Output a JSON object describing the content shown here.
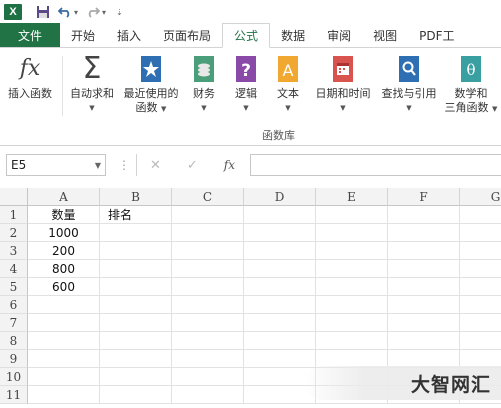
{
  "qat": {
    "app_icon": "X",
    "caret": "▾",
    "customize": "⇣"
  },
  "tabs": [
    "文件",
    "开始",
    "插入",
    "页面布局",
    "公式",
    "数据",
    "审阅",
    "视图",
    "PDF工"
  ],
  "active_tab": "公式",
  "ribbon": {
    "buttons": [
      {
        "label": "插入函数",
        "icon": "function-insert-icon"
      },
      {
        "label": "自动求和",
        "icon": "sigma-icon"
      },
      {
        "label": "最近使用的\n函数",
        "icon": "star-book-icon"
      },
      {
        "label": "财务",
        "icon": "coins-book-icon"
      },
      {
        "label": "逻辑",
        "icon": "question-book-icon"
      },
      {
        "label": "文本",
        "icon": "text-book-icon"
      },
      {
        "label": "日期和时间",
        "icon": "calendar-book-icon"
      },
      {
        "label": "查找与引用",
        "icon": "search-book-icon"
      },
      {
        "label": "数学和\n三角函数",
        "icon": "theta-book-icon"
      }
    ],
    "group_label": "函数库"
  },
  "formula_bar": {
    "name_box": "E5",
    "cancel": "✕",
    "enter": "✓",
    "fx": "fx",
    "value": ""
  },
  "columns": [
    "A",
    "B",
    "C",
    "D",
    "E",
    "F",
    "G"
  ],
  "rows": [
    "1",
    "2",
    "3",
    "4",
    "5",
    "6",
    "7",
    "8",
    "9",
    "10",
    "11"
  ],
  "cells": {
    "A1": "数量",
    "B1": "排名",
    "A2": "1000",
    "A3": "200",
    "A4": "800",
    "A5": "600"
  },
  "watermark": "大智网汇",
  "colors": {
    "brand_green": "#217346",
    "file_tab": "#217346"
  }
}
